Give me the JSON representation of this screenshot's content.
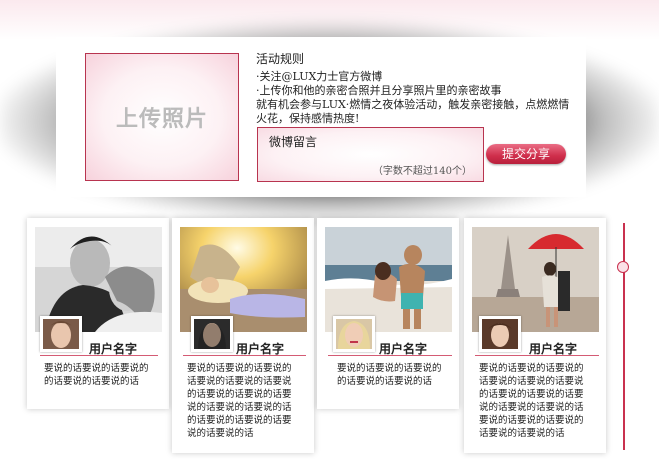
{
  "upload": {
    "label": "上传照片"
  },
  "rules": {
    "title": "活动规则",
    "line1": "·关注@LUX力士官方微博",
    "line2": "·上传你和他的亲密合照并且分享照片里的亲密故事",
    "line3": "就有机会参与LUX·燃情之夜体验活动，触发亲密接触，点燃燃情",
    "line4": "火花，保持感情热度!"
  },
  "comment": {
    "label": "微博留言",
    "hint": "（字数不超过140个）"
  },
  "submit": {
    "label": "提交分享"
  },
  "colors": {
    "accent": "#c9314f",
    "button": "#d0304e"
  },
  "cards": [
    {
      "photo_icon": "couple-bw-photo",
      "username": "用户名字",
      "line1": "要说的话要说的话要说的",
      "line2": "的话要说的话要说的话"
    },
    {
      "photo_icon": "couple-sunset-photo",
      "username": "用户名字",
      "line1": "要说的话要说的话要说的",
      "line2": "话要说的话要说的话要说",
      "line3": "的话要说的话要说的话要",
      "line4": "说的话要说的话要说的话",
      "line5": "的话要说的话要说的话要",
      "line6": "说的话要说的话"
    },
    {
      "photo_icon": "couple-beach-photo",
      "username": "用户名字",
      "line1": "要说的话要说的话要说的",
      "line2": "的话要说的话要说的话"
    },
    {
      "photo_icon": "couple-umbrella-photo",
      "username": "用户名字",
      "line1": "要说的话要说的话要说的",
      "line2": "话要说的话要说的话要说",
      "line3": "的话要说的话要说的话要",
      "line4": "说的话要说的话要说的话",
      "line5": "要说的话要说的话要说的",
      "line6": "话要说的话要说的话"
    }
  ]
}
